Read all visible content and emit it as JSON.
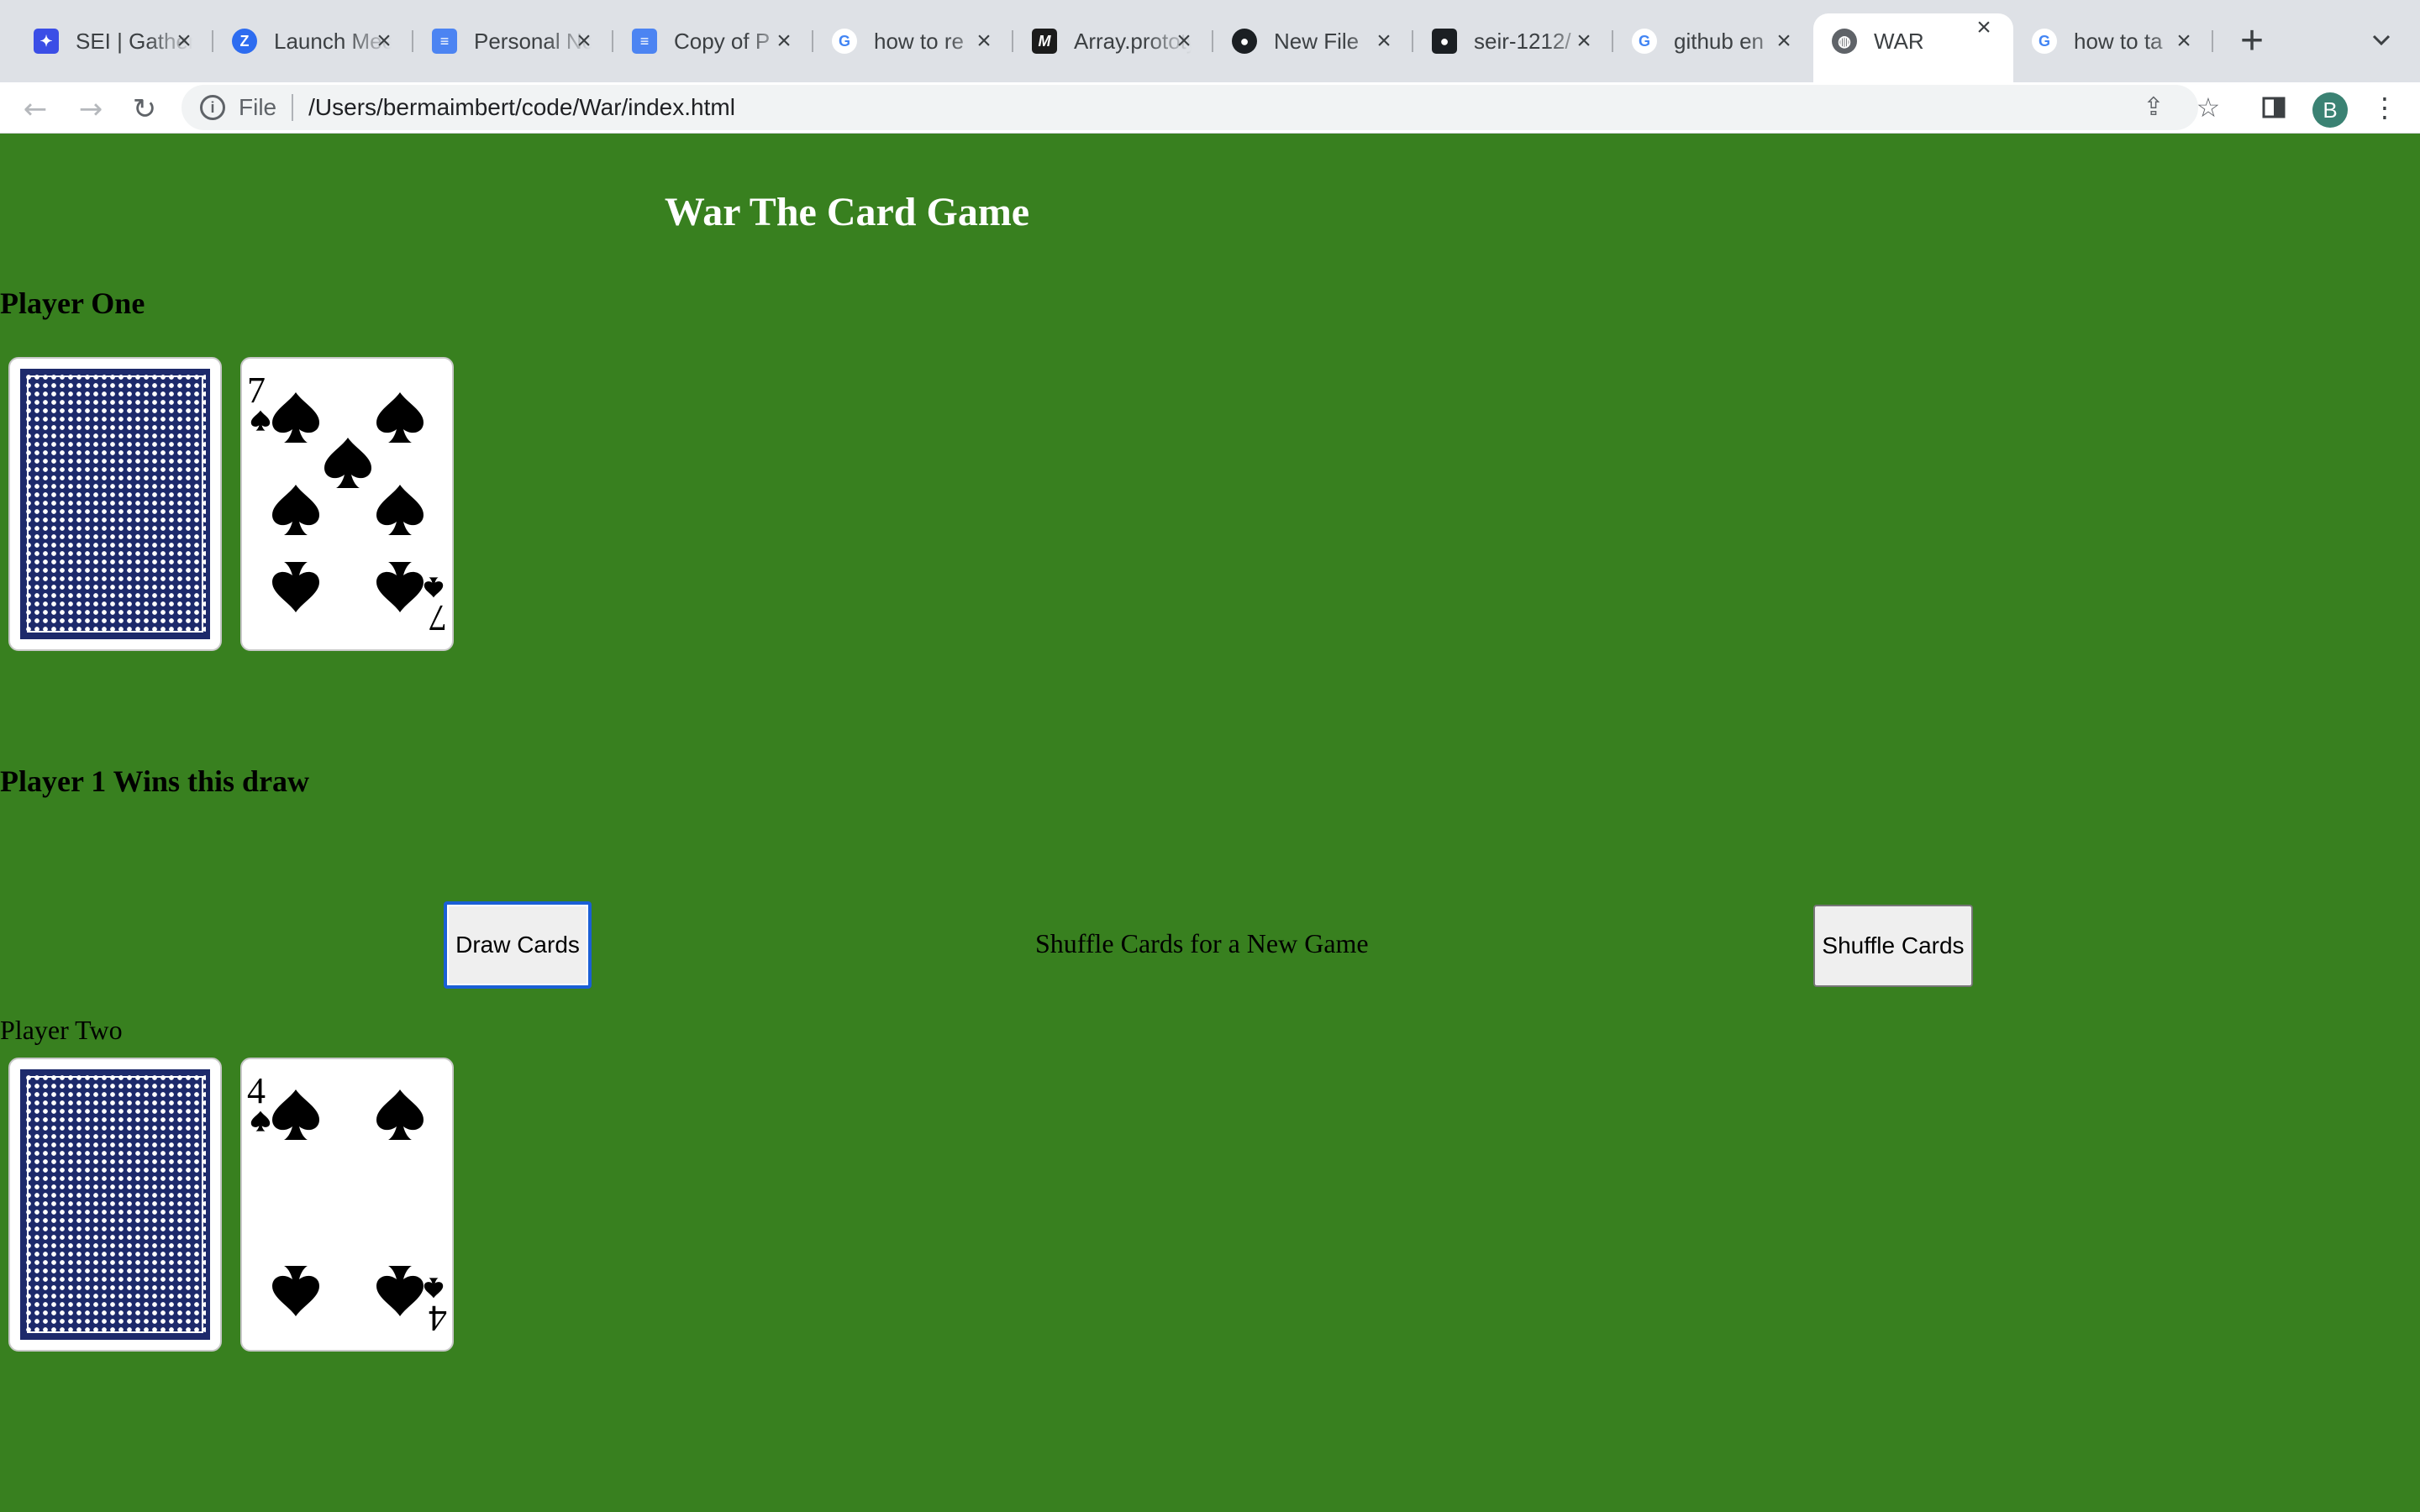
{
  "browser": {
    "tabs": [
      {
        "title": "SEI | Gather",
        "icon": "gather-icon",
        "color": "#3b4ee6"
      },
      {
        "title": "Launch Meeting - Zoom",
        "icon": "zoom-icon",
        "color": "#2d6cf0"
      },
      {
        "title": "Personal Notes",
        "icon": "google-docs-icon",
        "color": "#4c84f2"
      },
      {
        "title": "Copy of P",
        "icon": "google-docs-icon",
        "color": "#4c84f2"
      },
      {
        "title": "how to re",
        "icon": "google-icon",
        "color": "#ffffff"
      },
      {
        "title": "Array.prototype",
        "icon": "mdn-icon",
        "color": "#1b1b1b"
      },
      {
        "title": "New File",
        "icon": "github-icon",
        "color": "#1b1f23"
      },
      {
        "title": "seir-1212/",
        "icon": "github-icon",
        "color": "#1b1f23"
      },
      {
        "title": "github en",
        "icon": "google-icon",
        "color": "#ffffff"
      },
      {
        "title": "WAR",
        "icon": "globe-icon",
        "color": "#5f6368",
        "active": true
      },
      {
        "title": "how to ta",
        "icon": "google-icon",
        "color": "#ffffff"
      }
    ],
    "address": {
      "protocol_label": "File",
      "url": "/Users/bermaimbert/code/War/index.html"
    },
    "profile_initial": "B"
  },
  "page": {
    "title": "War The Card Game",
    "player_one": {
      "heading": "Player One",
      "card": {
        "rank": "7",
        "suit": "spades",
        "suit_symbol": "♠"
      }
    },
    "result_text": "Player 1 Wins this draw",
    "draw_button_label": "Draw Cards",
    "shuffle_caption": "Shuffle Cards for a New Game",
    "shuffle_button_label": "Shuffle Cards",
    "player_two": {
      "heading": "Player Two",
      "card": {
        "rank": "4",
        "suit": "spades",
        "suit_symbol": "♠"
      }
    },
    "colors": {
      "background": "#38801f",
      "card_back": "#1d2a6b",
      "focus_ring": "#1a5fd6"
    }
  }
}
